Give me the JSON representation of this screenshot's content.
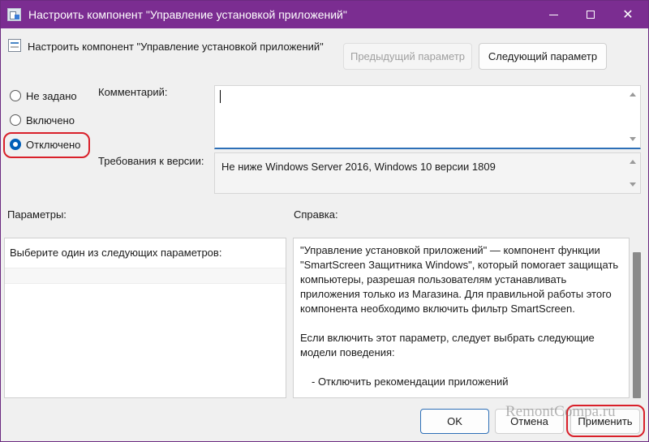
{
  "window": {
    "title": "Настроить компонент \"Управление установкой приложений\"",
    "minimize_glyph": "—",
    "maximize_glyph": "□",
    "close_glyph": "✕"
  },
  "header": {
    "title": "Настроить компонент \"Управление установкой приложений\"",
    "prev_button": "Предыдущий параметр",
    "next_button": "Следующий параметр"
  },
  "state_options": [
    {
      "label": "Не задано",
      "checked": false
    },
    {
      "label": "Включено",
      "checked": false
    },
    {
      "label": "Отключено",
      "checked": true
    }
  ],
  "comment": {
    "label": "Комментарий:",
    "value": ""
  },
  "requirements": {
    "label": "Требования к версии:",
    "value": "Не ниже Windows Server 2016, Windows 10 версии 1809"
  },
  "params": {
    "label": "Параметры:",
    "text": "Выберите один из следующих параметров:"
  },
  "help": {
    "label": "Справка:",
    "paragraph1": "\"Управление установкой приложений\" — компонент функции \"SmartScreen Защитника Windows\", который помогает защищать компьютеры, разрешая пользователям устанавливать приложения только из Магазина. Для правильной работы этого компонента необходимо включить фильтр SmartScreen.",
    "paragraph2": "Если включить этот параметр, следует выбрать следующие модели поведения:",
    "paragraph3": "- Отключить рекомендации приложений"
  },
  "footer": {
    "ok": "OK",
    "cancel": "Отмена",
    "apply": "Применить"
  },
  "watermark": "RemontCompa.ru",
  "colors": {
    "titlebar": "#7b2d91",
    "highlight": "#d9202a",
    "accent": "#005fb8"
  }
}
